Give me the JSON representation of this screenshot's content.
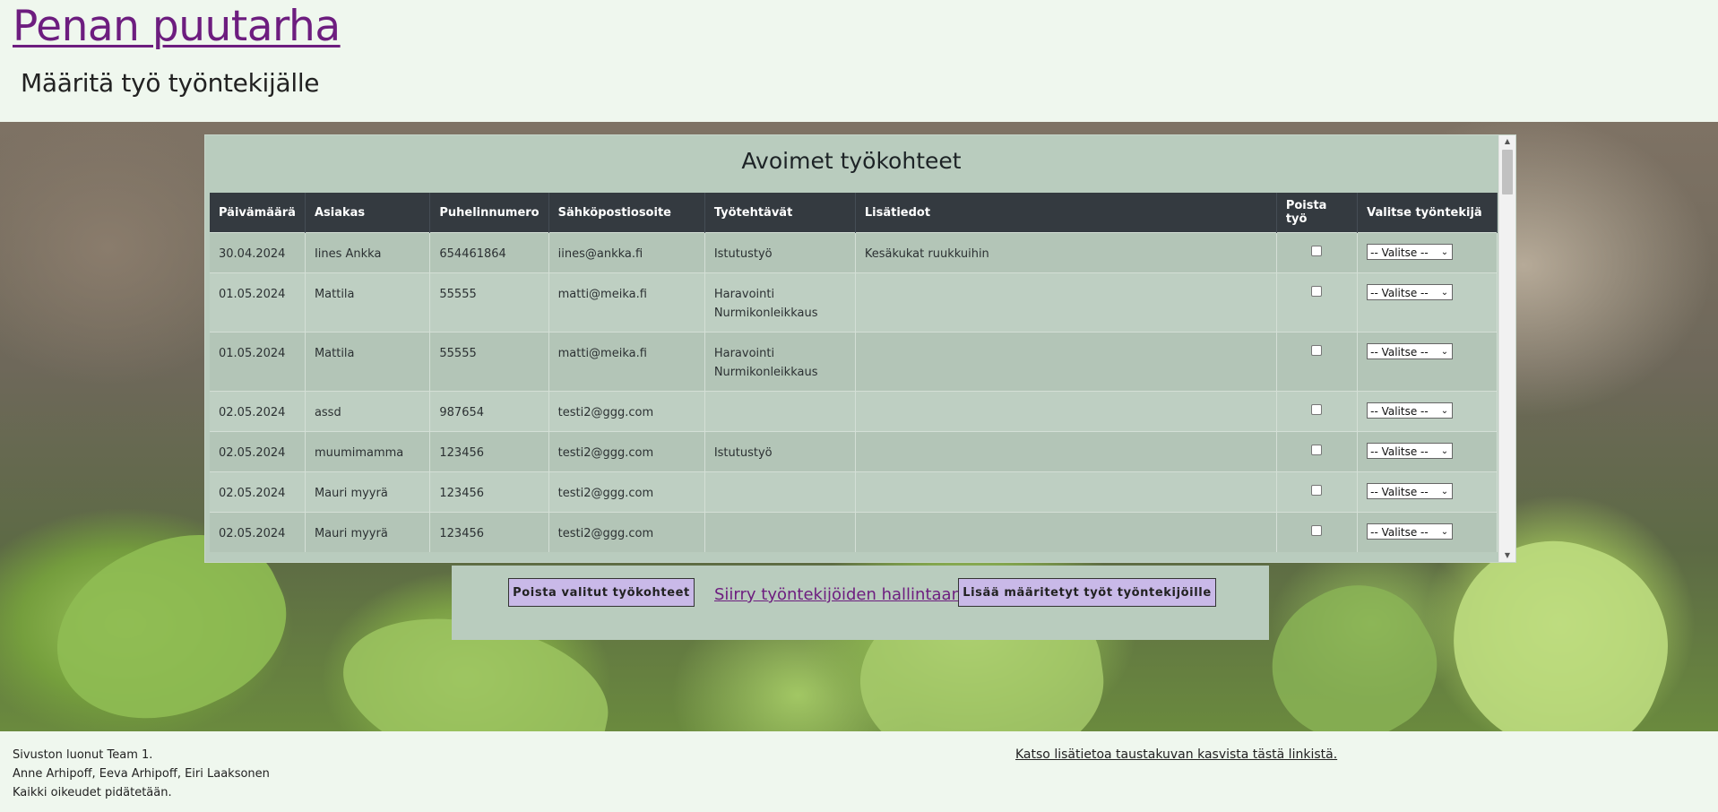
{
  "header": {
    "site_title": "Penan puutarha",
    "page_heading": "Määritä työ työntekijälle"
  },
  "table": {
    "title": "Avoimet työkohteet",
    "columns": [
      "Päivämäärä",
      "Asiakas",
      "Puhelinnumero",
      "Sähköpostiosoite",
      "Työtehtävät",
      "Lisätiedot",
      "Poista työ",
      "Valitse työntekijä"
    ],
    "rows": [
      {
        "date": "30.04.2024",
        "customer": "Iines Ankka",
        "phone": "654461864",
        "email": "iines@ankka.fi",
        "tasks": [
          "Istutustyö"
        ],
        "info": "Kesäkukat ruukkuihin",
        "select": "-- Valitse --"
      },
      {
        "date": "01.05.2024",
        "customer": "Mattila",
        "phone": "55555",
        "email": "matti@meika.fi",
        "tasks": [
          "Haravointi",
          "Nurmikonleikkaus"
        ],
        "info": "",
        "select": "-- Valitse --"
      },
      {
        "date": "01.05.2024",
        "customer": "Mattila",
        "phone": "55555",
        "email": "matti@meika.fi",
        "tasks": [
          "Haravointi",
          "Nurmikonleikkaus"
        ],
        "info": "",
        "select": "-- Valitse --"
      },
      {
        "date": "02.05.2024",
        "customer": "assd",
        "phone": "987654",
        "email": "testi2@ggg.com",
        "tasks": [],
        "info": "",
        "select": "-- Valitse --"
      },
      {
        "date": "02.05.2024",
        "customer": "muumimamma",
        "phone": "123456",
        "email": "testi2@ggg.com",
        "tasks": [
          "Istutustyö"
        ],
        "info": "",
        "select": "-- Valitse --"
      },
      {
        "date": "02.05.2024",
        "customer": "Mauri myyrä",
        "phone": "123456",
        "email": "testi2@ggg.com",
        "tasks": [],
        "info": "",
        "select": "-- Valitse --"
      },
      {
        "date": "02.05.2024",
        "customer": "Mauri myyrä",
        "phone": "123456",
        "email": "testi2@ggg.com",
        "tasks": [],
        "info": "",
        "select": "-- Valitse --"
      }
    ]
  },
  "actions": {
    "delete_label": "Poista valitut työkohteet",
    "manage_link": "Siirry työntekijöiden hallintaan",
    "add_label": "Lisää määritetyt työt työntekijöille"
  },
  "footer": {
    "credits": [
      "Sivuston luonut Team 1.",
      "Anne Arhipoff, Eeva Arhipoff, Eiri Laaksonen",
      "Kaikki oikeudet pidätetään."
    ],
    "background_link": "Katso lisätietoa taustakuvan kasvista tästä linkistä."
  },
  "colors": {
    "page_bg": "#eff7ee",
    "title_link": "#6d1d7f",
    "table_header": "#343a40",
    "button_bg": "#c9b9e8"
  },
  "icons": {
    "scroll_up": "triangle-up-icon",
    "scroll_down": "triangle-down-icon",
    "select_arrow": "chevron-down-icon"
  }
}
